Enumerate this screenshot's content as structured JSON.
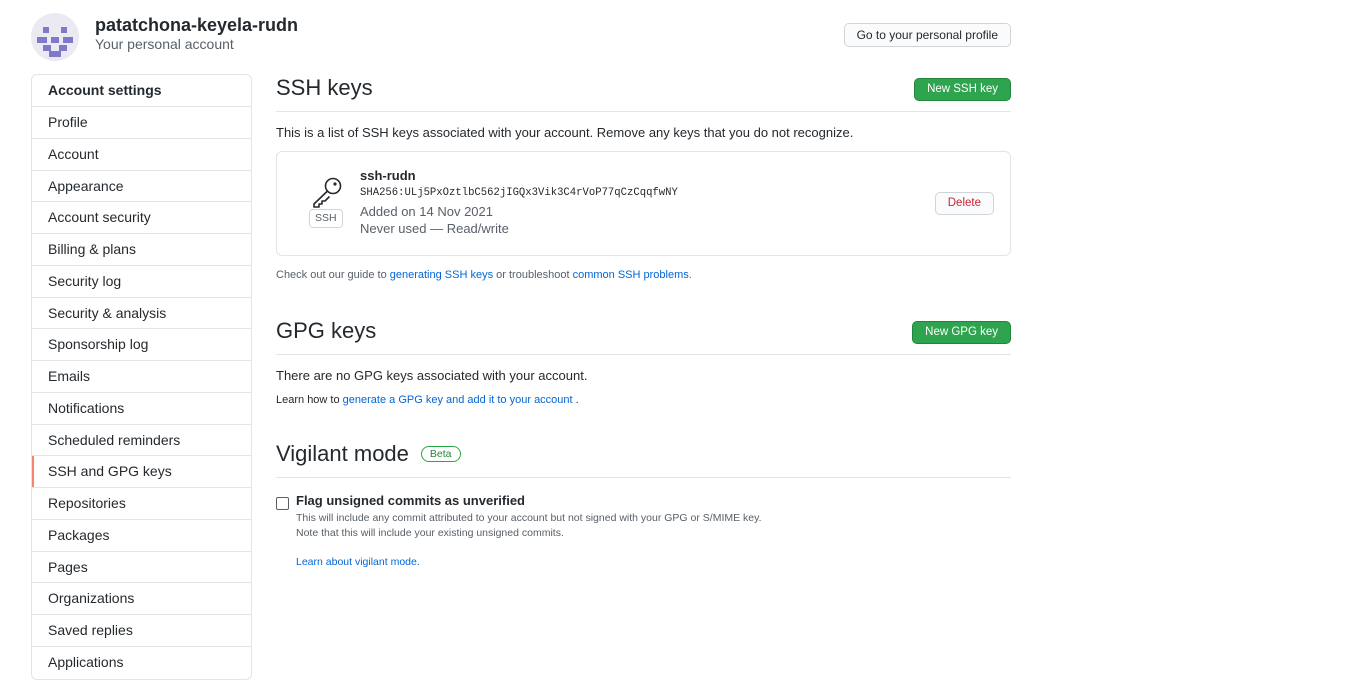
{
  "account": {
    "name": "patatchona-keyela-rudn",
    "subtitle": "Your personal account",
    "profile_button": "Go to your personal profile"
  },
  "sidebar": {
    "heading": "Account settings",
    "selected": "SSH and GPG keys",
    "items": [
      {
        "label": "Profile"
      },
      {
        "label": "Account"
      },
      {
        "label": "Appearance"
      },
      {
        "label": "Account security"
      },
      {
        "label": "Billing & plans"
      },
      {
        "label": "Security log"
      },
      {
        "label": "Security & analysis"
      },
      {
        "label": "Sponsorship log"
      },
      {
        "label": "Emails"
      },
      {
        "label": "Notifications"
      },
      {
        "label": "Scheduled reminders"
      },
      {
        "label": "SSH and GPG keys"
      },
      {
        "label": "Repositories"
      },
      {
        "label": "Packages"
      },
      {
        "label": "Pages"
      },
      {
        "label": "Organizations"
      },
      {
        "label": "Saved replies"
      },
      {
        "label": "Applications"
      }
    ]
  },
  "ssh": {
    "title": "SSH keys",
    "new_button": "New SSH key",
    "description": "This is a list of SSH keys associated with your account. Remove any keys that you do not recognize.",
    "key": {
      "title": "ssh-rudn",
      "badge": "SSH",
      "fingerprint": "SHA256:ULj5PxOztlbC562jIGQx3Vik3C4rVoP77qCzCqqfwNY",
      "added": "Added on 14 Nov 2021",
      "usage": "Never used — Read/write",
      "delete_button": "Delete"
    },
    "guide": {
      "prefix": "Check out our guide to",
      "link1": "generating SSH keys",
      "middle": "or troubleshoot",
      "link2": "common SSH problems",
      "suffix": "."
    }
  },
  "gpg": {
    "title": "GPG keys",
    "new_button": "New GPG key",
    "description": "There are no GPG keys associated with your account.",
    "learn": {
      "prefix": "Learn how to",
      "link": "generate a GPG key and add it to your account",
      "suffix": "."
    }
  },
  "vigilant": {
    "title": "Vigilant mode",
    "badge": "Beta",
    "checkbox_label": "Flag unsigned commits as unverified",
    "checked": false,
    "note1": "This will include any commit attributed to your account but not signed with your GPG or S/MIME key.",
    "note2": "Note that this will include your existing unsigned commits.",
    "learn_link": "Learn about vigilant mode."
  },
  "colors": {
    "green": "#2ea44f",
    "link": "#0366d6",
    "danger": "#cb2431",
    "selected_indicator": "#f9826c"
  }
}
